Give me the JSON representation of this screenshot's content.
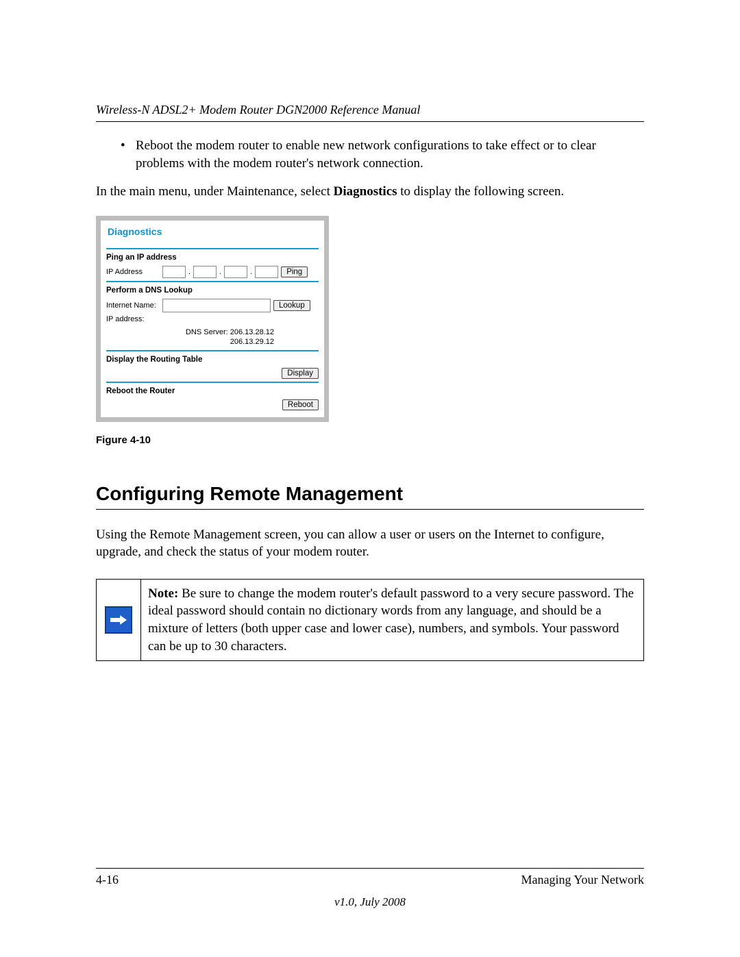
{
  "header": {
    "title": "Wireless-N ADSL2+ Modem Router DGN2000 Reference Manual"
  },
  "bullet": {
    "text": "Reboot the modem router to enable new network configurations to take effect or to clear problems with the modem router's network connection."
  },
  "intro": {
    "pre": "In the main menu, under Maintenance, select ",
    "bold": "Diagnostics",
    "post": " to display the following screen."
  },
  "shot": {
    "title": "Diagnostics",
    "ping": {
      "header": "Ping an IP address",
      "label": "IP Address",
      "button": "Ping"
    },
    "dns": {
      "header": "Perform a DNS Lookup",
      "name_label": "Internet Name:",
      "ip_label": "IP address:",
      "lookup_button": "Lookup",
      "server_line": "DNS Server: 206.13.28.12",
      "server_line2": "206.13.29.12"
    },
    "routing": {
      "header": "Display the Routing Table",
      "button": "Display"
    },
    "reboot": {
      "header": "Reboot the Router",
      "button": "Reboot"
    }
  },
  "figure_caption": "Figure 4-10",
  "section_heading": "Configuring Remote Management",
  "section_para": "Using the Remote Management screen, you can allow a user or users on the Internet to configure, upgrade, and check the status of your modem router.",
  "note": {
    "label": "Note: ",
    "text": "Be sure to change the modem router's default password to a very secure password. The ideal password should contain no dictionary words from any language, and should be a mixture of letters (both upper case and lower case), numbers, and symbols. Your password can be up to 30 characters."
  },
  "footer": {
    "page": "4-16",
    "chapter": "Managing Your Network",
    "version": "v1.0, July 2008"
  }
}
